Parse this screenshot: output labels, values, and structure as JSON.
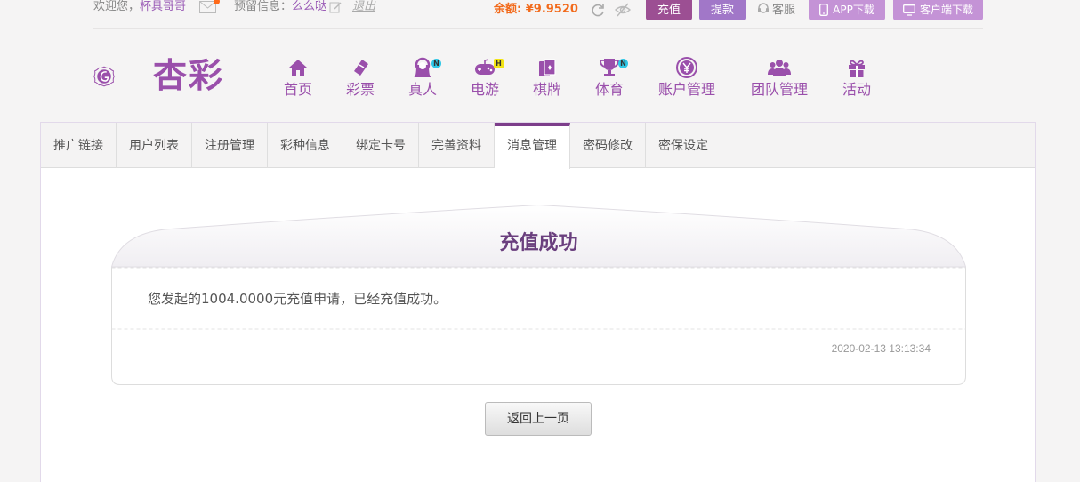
{
  "topbar": {
    "welcome_prefix": "欢迎您，",
    "username": "杯具哥哥",
    "reserve_prefix": "预留信息：",
    "reserve_value": "么么哒",
    "logout": "退出",
    "balance_label": "余额: ¥9.9520",
    "recharge": "充值",
    "withdraw": "提款",
    "service": "客服",
    "app_download": "APP下载",
    "client_download": "客户端下载"
  },
  "logo": {
    "text": "杏彩"
  },
  "nav": [
    {
      "label": "首页",
      "icon": "home-icon"
    },
    {
      "label": "彩票",
      "icon": "ticket-icon"
    },
    {
      "label": "真人",
      "icon": "dealer-icon",
      "badge": "N"
    },
    {
      "label": "电游",
      "icon": "gamepad-icon",
      "badge": "H"
    },
    {
      "label": "棋牌",
      "icon": "cards-icon"
    },
    {
      "label": "体育",
      "icon": "trophy-icon",
      "badge": "N"
    },
    {
      "label": "账户管理",
      "icon": "yen-coin-icon"
    },
    {
      "label": "团队管理",
      "icon": "team-icon"
    },
    {
      "label": "活动",
      "icon": "gift-icon"
    }
  ],
  "tabs": [
    {
      "label": "推广链接"
    },
    {
      "label": "用户列表"
    },
    {
      "label": "注册管理"
    },
    {
      "label": "彩种信息"
    },
    {
      "label": "绑定卡号"
    },
    {
      "label": "完善资料"
    },
    {
      "label": "消息管理",
      "active": true
    },
    {
      "label": "密码修改"
    },
    {
      "label": "密保设定"
    }
  ],
  "message": {
    "title": "充值成功",
    "body": "您发起的1004.0000元充值申请，已经充值成功。",
    "timestamp": "2020-02-13 13:13:34"
  },
  "back_button": "返回上一页",
  "colors": {
    "brand_purple": "#9a4fab",
    "tab_active": "#7d3e8b",
    "balance_orange": "#f26a1b",
    "badge_cyan": "#2fc7e6",
    "badge_yellow": "#f2e415"
  }
}
